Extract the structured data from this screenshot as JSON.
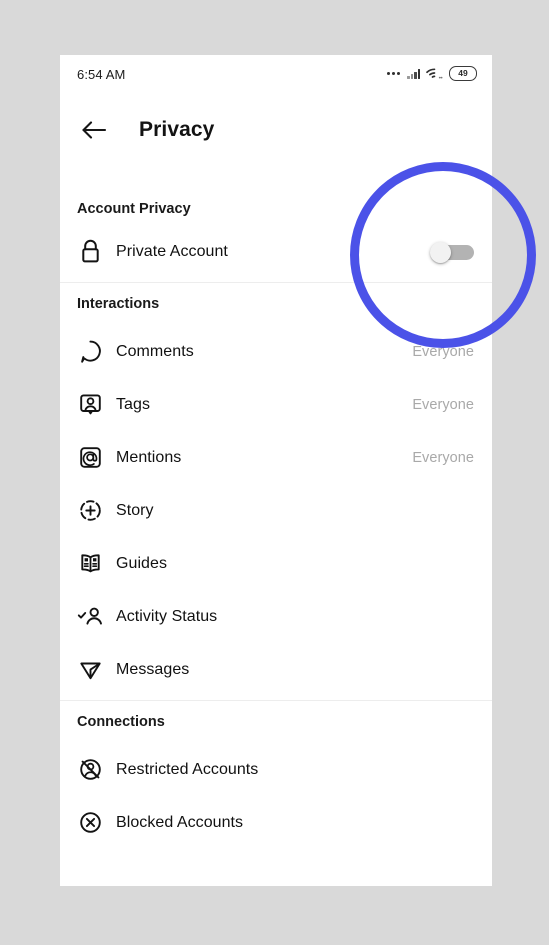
{
  "status_bar": {
    "time": "6:54 AM",
    "battery_level": "49",
    "icons": [
      "more-dots-icon",
      "signal-bars-icon",
      "wifi-icon",
      "battery-icon"
    ]
  },
  "header": {
    "back_icon": "arrow-left-icon",
    "title": "Privacy"
  },
  "annotation": {
    "shape": "circle",
    "color": "#4b52e8",
    "target": "private-account-toggle"
  },
  "sections": [
    {
      "id": "account-privacy",
      "title": "Account Privacy",
      "rows": [
        {
          "id": "private-account",
          "icon": "lock-icon",
          "label": "Private Account",
          "control": "toggle",
          "toggle_state": "off"
        }
      ]
    },
    {
      "id": "interactions",
      "title": "Interactions",
      "rows": [
        {
          "id": "comments",
          "icon": "comment-bubble-icon",
          "label": "Comments",
          "value": "Everyone"
        },
        {
          "id": "tags",
          "icon": "tag-person-icon",
          "label": "Tags",
          "value": "Everyone"
        },
        {
          "id": "mentions",
          "icon": "at-mention-icon",
          "label": "Mentions",
          "value": "Everyone"
        },
        {
          "id": "story",
          "icon": "story-plus-icon",
          "label": "Story",
          "value": ""
        },
        {
          "id": "guides",
          "icon": "guides-book-icon",
          "label": "Guides",
          "value": ""
        },
        {
          "id": "activity-status",
          "icon": "person-check-icon",
          "label": "Activity Status",
          "value": ""
        },
        {
          "id": "messages",
          "icon": "paper-plane-icon",
          "label": "Messages",
          "value": ""
        }
      ]
    },
    {
      "id": "connections",
      "title": "Connections",
      "rows": [
        {
          "id": "restricted-accounts",
          "icon": "person-slash-icon",
          "label": "Restricted Accounts",
          "value": ""
        },
        {
          "id": "blocked-accounts",
          "icon": "x-circle-icon",
          "label": "Blocked Accounts",
          "value": ""
        }
      ]
    }
  ]
}
